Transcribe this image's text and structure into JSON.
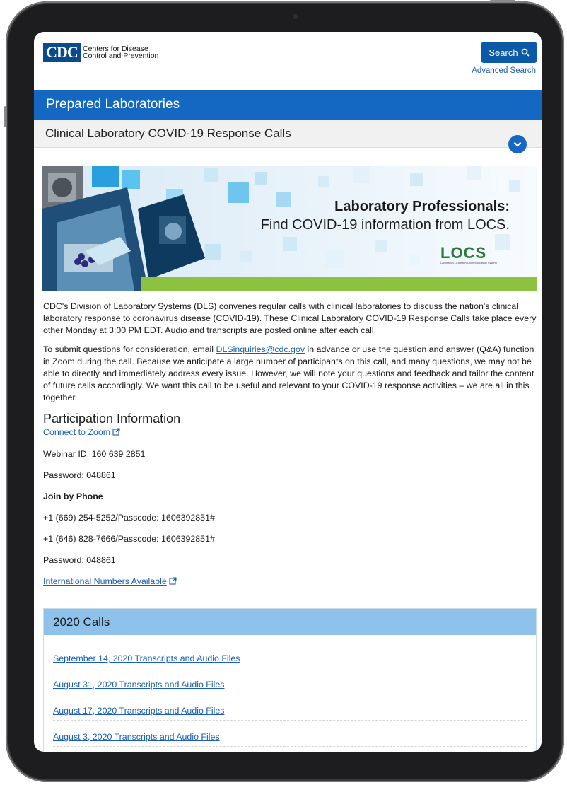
{
  "header": {
    "logo_mark": "CDC",
    "logo_line1": "Centers for Disease",
    "logo_line2": "Control and Prevention",
    "search_label": "Search",
    "advanced_search": "Advanced Search"
  },
  "title_bar": "Prepared Laboratories",
  "subtitle_bar": "Clinical Laboratory COVID-19 Response Calls",
  "banner": {
    "headline": "Laboratory Professionals:",
    "subline": "Find COVID-19 information from LOCS.",
    "locs_word": "LOCS",
    "locs_tag": "Laboratory Outreach Communication System"
  },
  "content": {
    "para1": "CDC's Division of Laboratory Systems (DLS) convenes regular calls with clinical laboratories to discuss the nation's clinical laboratory response to coronavirus disease (COVID-19). These Clinical Laboratory COVID-19 Response Calls take place every other Monday at 3:00 PM EDT. Audio and transcripts are posted online after each call.",
    "para2_before": "To submit questions for consideration, email ",
    "para2_email": "DLSinquiries@cdc.gov",
    "para2_after": " in advance or use the question and answer (Q&A) function in Zoom during the call. Because we anticipate a large number of participants on this call, and many questions, we may not be able to directly and immediately address every issue. However, we will note your questions and feedback and tailor the content of future calls accordingly. We want this call to be useful and relevant to your COVID-19 response activities – we are all in this together.",
    "participation_heading": "Participation Information",
    "zoom_link": "Connect to Zoom",
    "webinar_id": "Webinar ID: 160 639 2851",
    "password1": "Password: 048861",
    "join_phone": "Join by Phone",
    "phone1": "+1 (669) 254-5252/Passcode: 1606392851#",
    "phone2": "+1 (646) 828-7666/Passcode: 1606392851#",
    "password2": "Password: 048861",
    "intl_link": "International Numbers Available"
  },
  "accordion": {
    "heading": "2020 Calls",
    "items": [
      "September 14, 2020 Transcripts and Audio Files",
      "August 31, 2020 Transcripts and Audio Files",
      "August 17, 2020 Transcripts and Audio Files",
      "August 3, 2020 Transcripts and Audio Files"
    ]
  },
  "colors": {
    "brand_blue": "#1468c2",
    "link_blue": "#1a5fb4",
    "accordion_blue": "#8fc2ea",
    "locs_green": "#8cc23f"
  }
}
